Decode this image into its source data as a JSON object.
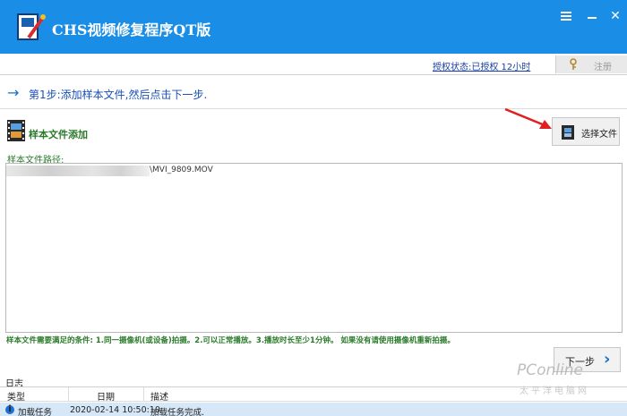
{
  "window": {
    "title": "CHS视频修复程序QT版",
    "controls": {
      "menu_icon": "hamburger-icon",
      "minimize_icon": "minimize-icon",
      "close_icon": "close-icon"
    }
  },
  "license": {
    "status_text": "授权状态:已授权 12小时",
    "register_label": "注册",
    "register_icon": "key-icon"
  },
  "step": {
    "arrow_icon": "arrow-right-icon",
    "text": "第1步:添加样本文件,然后点击下一步."
  },
  "sample": {
    "title": "样本文件添加",
    "icon": "film-icon",
    "choose_button": "选择文件",
    "path_label": "样本文件路径:",
    "path_value": "\\MVI_9809.MOV",
    "conditions": "样本文件需要满足的条件: 1.同一摄像机(或设备)拍摄。2.可以正常播放。3.播放时长至少1分钟。 如果没有请使用摄像机重新拍摄。"
  },
  "navigation": {
    "next_label": "下一步",
    "next_icon": "chevron-right-icon"
  },
  "log": {
    "title": "日志",
    "columns": [
      "类型",
      "日期",
      "描述"
    ],
    "rows": [
      {
        "icon": "info-icon",
        "type": "加载任务",
        "date": "2020-02-14 10:50:10",
        "description": "加载任务完成."
      }
    ]
  },
  "watermark": {
    "text": "PConline",
    "sub": "太平洋电脑网"
  },
  "colors": {
    "titlebar": "#1a8ee6",
    "accent_green": "#2a7a2a",
    "link_blue": "#1a4fb8",
    "log_row": "#d6e8f8"
  }
}
